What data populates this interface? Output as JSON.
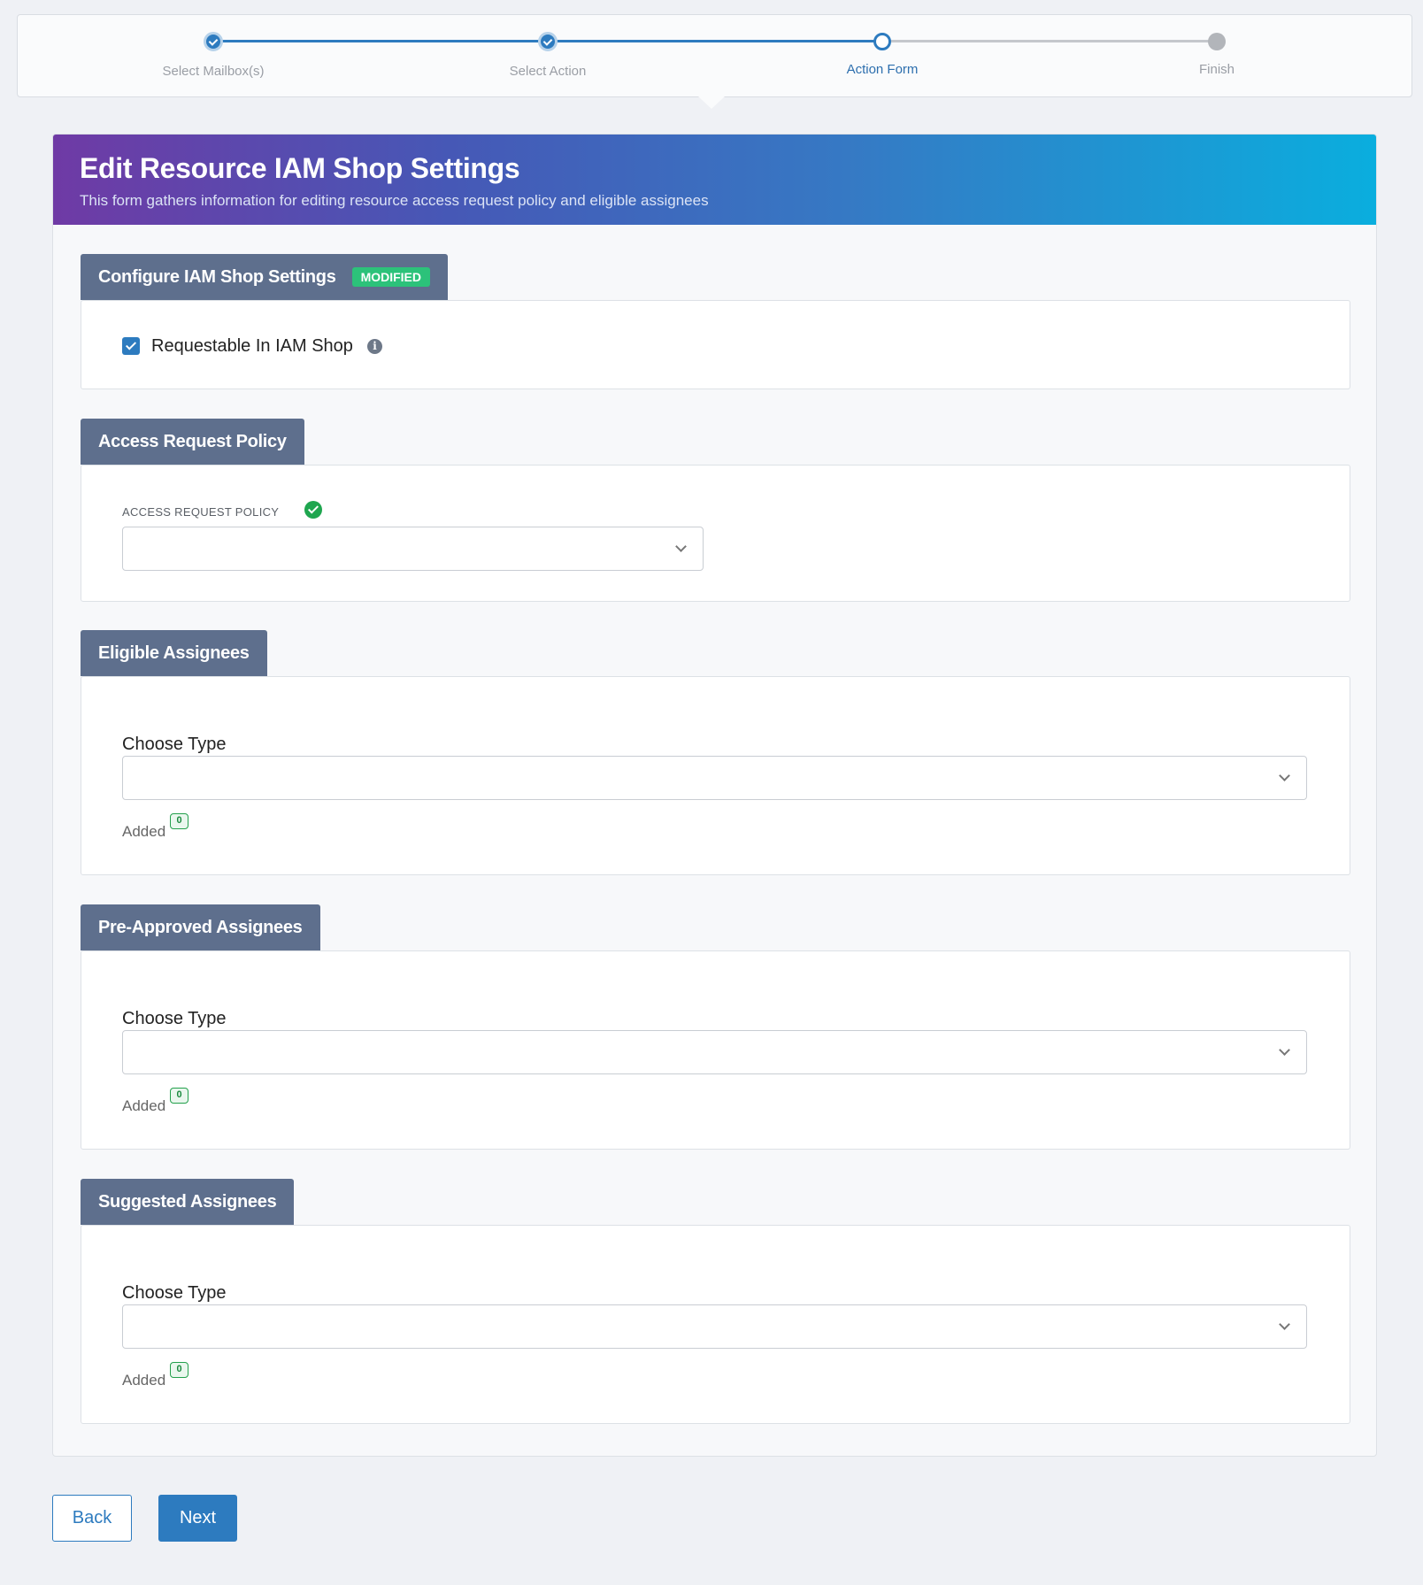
{
  "stepper": {
    "steps": [
      {
        "label": "Select Mailbox(s)",
        "state": "done"
      },
      {
        "label": "Select Action",
        "state": "done"
      },
      {
        "label": "Action Form",
        "state": "current"
      },
      {
        "label": "Finish",
        "state": "todo"
      }
    ]
  },
  "form": {
    "title": "Edit Resource IAM Shop Settings",
    "subtitle": "This form gathers information for editing resource access request policy and eligible assignees"
  },
  "config_section": {
    "title": "Configure IAM Shop Settings",
    "badge": "MODIFIED",
    "checkbox_label": "Requestable In IAM Shop",
    "checkbox_checked": true,
    "info_icon": "info-icon"
  },
  "policy_section": {
    "title": "Access Request Policy",
    "field_label": "ACCESS REQUEST POLICY",
    "field_value": ""
  },
  "eligible_section": {
    "title": "Eligible Assignees",
    "choose_label": "Choose Type",
    "choose_value": "",
    "added_label": "Added",
    "added_count": "0"
  },
  "preapproved_section": {
    "title": "Pre-Approved Assignees",
    "choose_label": "Choose Type",
    "choose_value": "",
    "added_label": "Added",
    "added_count": "0"
  },
  "suggested_section": {
    "title": "Suggested Assignees",
    "choose_label": "Choose Type",
    "choose_value": "",
    "added_label": "Added",
    "added_count": "0"
  },
  "buttons": {
    "back": "Back",
    "next": "Next"
  },
  "colors": {
    "primary": "#2d7bbf",
    "section_tab": "#5e6f8d",
    "modified_badge": "#2cc27a",
    "success": "#1fa64f"
  }
}
